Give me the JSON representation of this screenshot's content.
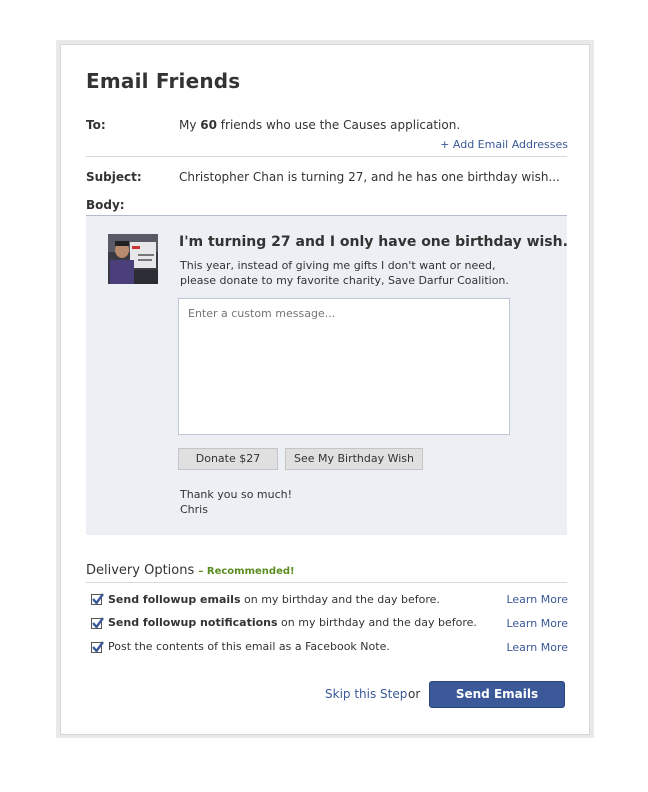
{
  "header": {
    "title": "Email Friends"
  },
  "to": {
    "label": "To:",
    "value_prefix": "My ",
    "value_count": "60",
    "value_suffix": " friends who use the Causes application.",
    "add_link": "+ Add Email Addresses"
  },
  "subject": {
    "label": "Subject:",
    "value": "Christopher Chan is turning 27, and he has one birthday wish..."
  },
  "body": {
    "label": "Body:",
    "avatar_icon": "profile-photo",
    "headline": "I'm turning 27 and I only have one birthday wish.",
    "paragraph_line1": "This year, instead of giving me gifts I don't want or need,",
    "paragraph_line2": "please donate to my favorite charity, Save Darfur Coalition.",
    "custom_message_placeholder": "Enter a custom message...",
    "donate_button": "Donate $27",
    "birthday_wish_button": "See My Birthday Wish",
    "thanks_line1": "Thank you so much!",
    "thanks_line2": "Chris"
  },
  "delivery": {
    "title": "Delivery Options",
    "recommended": "– Recommended!",
    "options": [
      {
        "bold": "Send followup emails",
        "rest": " on my birthday and the day before.",
        "checked": true,
        "learn_more": "Learn More"
      },
      {
        "bold": "Send followup notifications",
        "rest": " on my birthday and the day before.",
        "checked": true,
        "learn_more": "Learn More"
      },
      {
        "bold": "",
        "rest": "Post the contents of this email as a Facebook Note.",
        "checked": true,
        "learn_more": "Learn More"
      }
    ]
  },
  "footer": {
    "skip_link": "Skip this Step",
    "or_text": "or",
    "send_button": "Send Emails"
  },
  "colors": {
    "link": "#3b5998",
    "button_primary": "#3b5998",
    "recommended": "#5a8c1f",
    "body_bg": "#eceff4"
  }
}
